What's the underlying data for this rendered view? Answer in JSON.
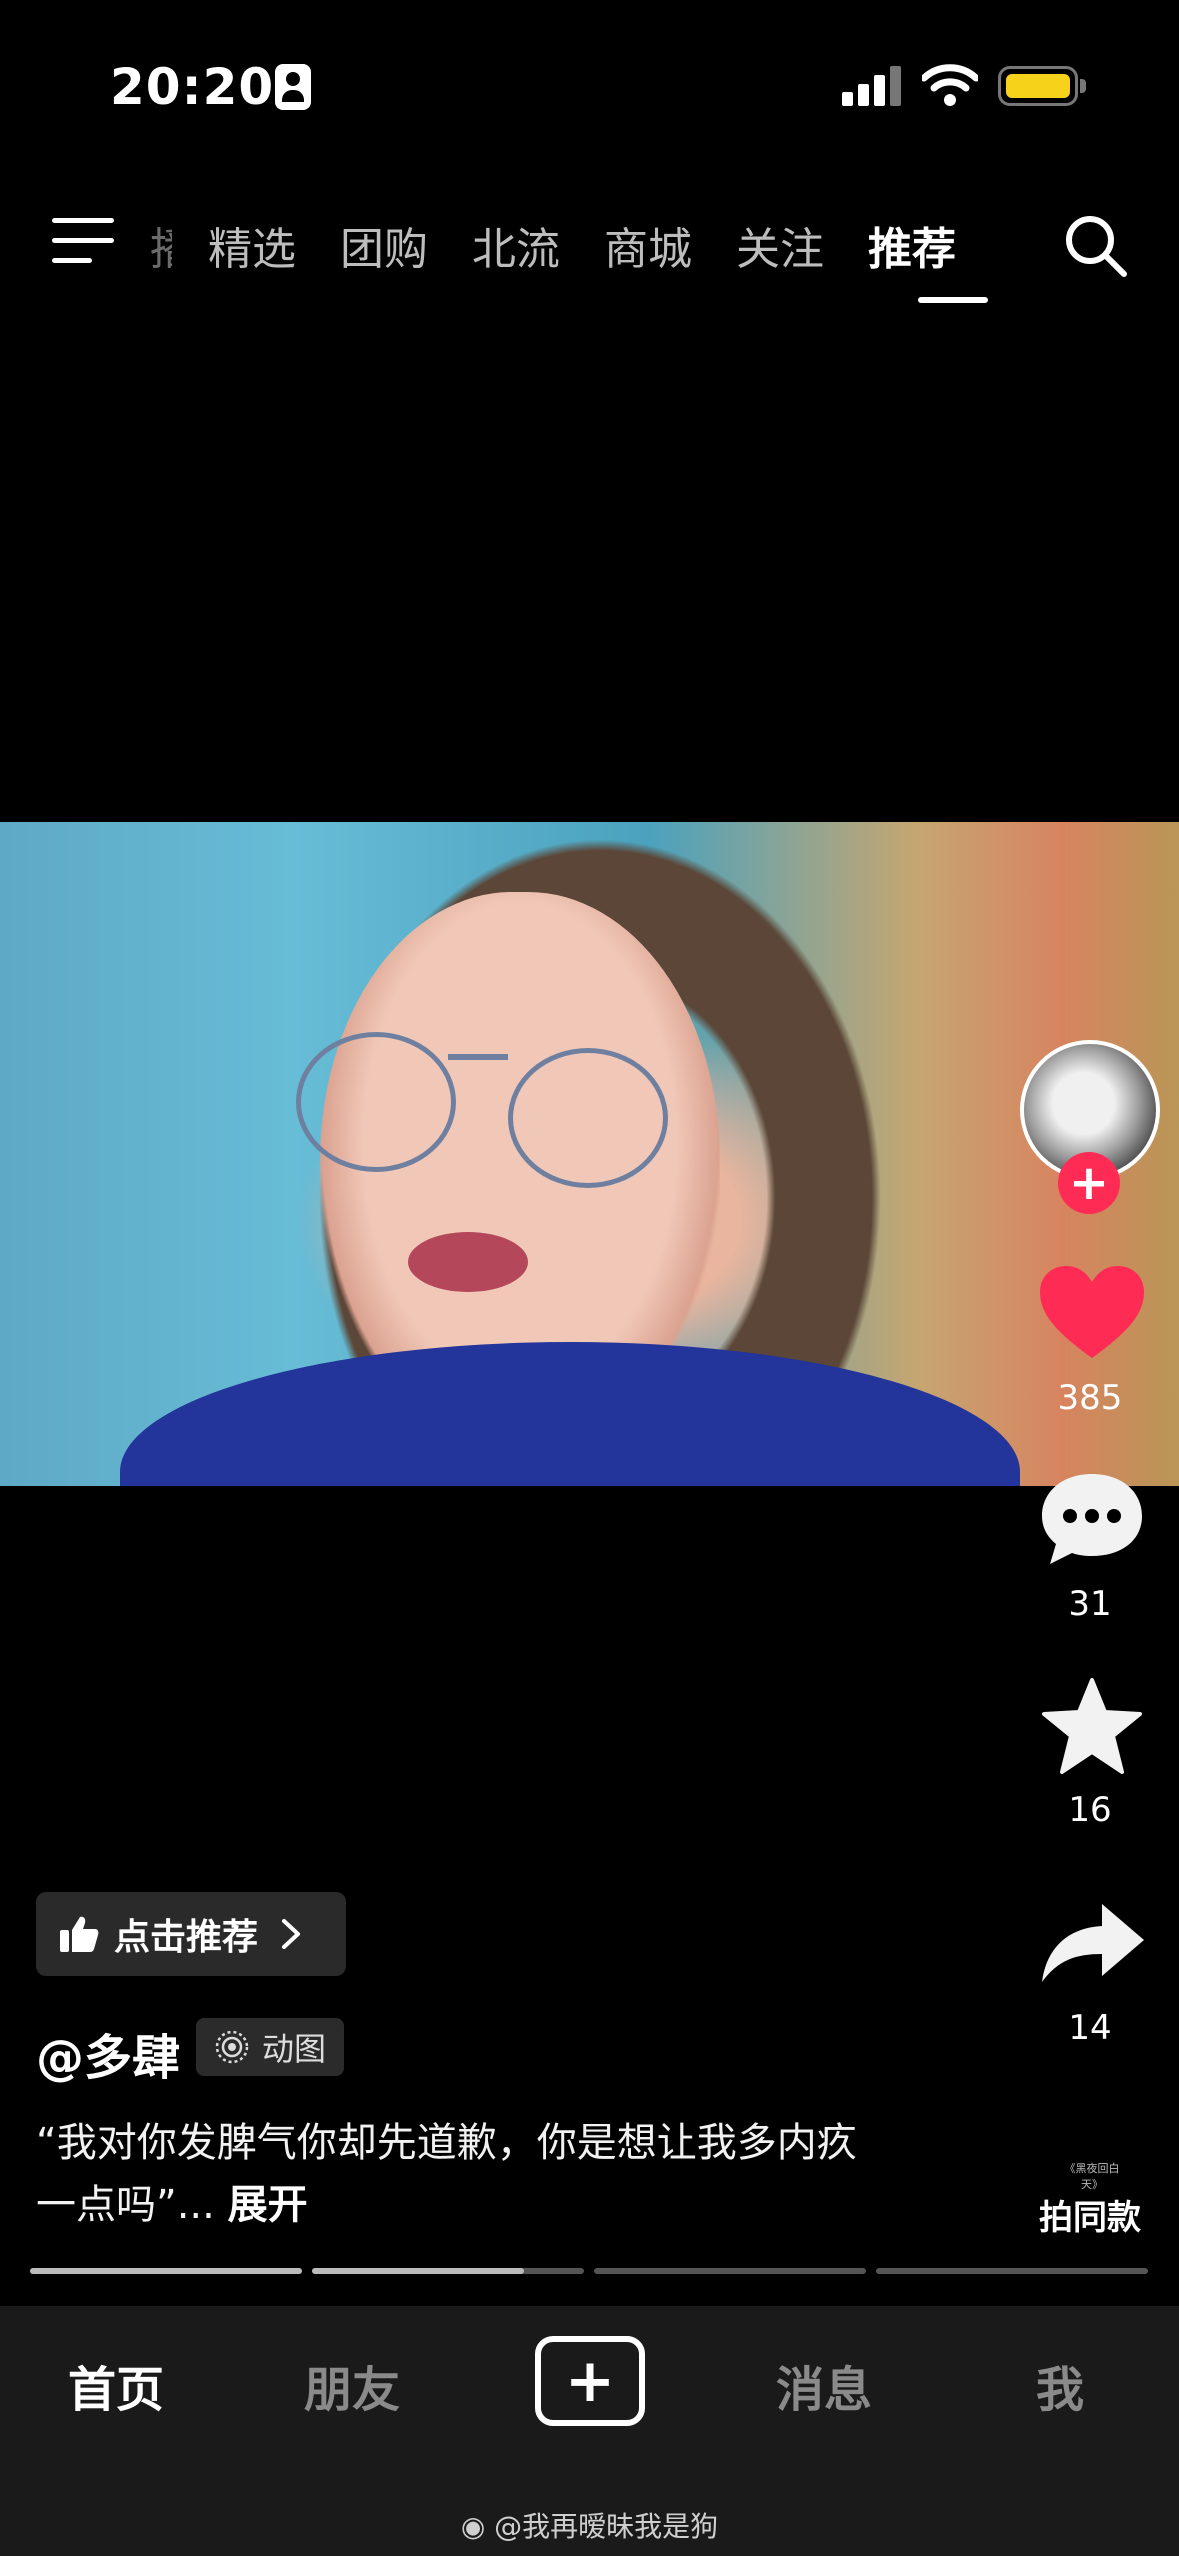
{
  "status_bar": {
    "time": "20:20",
    "battery_color": "#f6d21a"
  },
  "top_nav": {
    "tabs": [
      "播",
      "精选",
      "团购",
      "北流",
      "商城",
      "关注",
      "推荐"
    ],
    "active_tab": "推荐",
    "icons": {
      "menu": "menu-icon",
      "search": "search-icon"
    }
  },
  "right_rail": {
    "likes": "385",
    "comments": "31",
    "favorites": "16",
    "shares": "14",
    "same_style_label": "拍同款",
    "same_style_thumb_text": "《黑夜回白天》",
    "like_color": "#fe2c55"
  },
  "video_info": {
    "recommend_chip": "点击推荐",
    "username": "@多肆",
    "badge": "动图",
    "caption": "“我对你发脾气你却先道歉，你是想让我多内疚一点吗”...",
    "expand_label": "展开"
  },
  "progress": {
    "segments": [
      1.0,
      0.78,
      0,
      0
    ]
  },
  "tab_bar": {
    "home": "首页",
    "friends": "朋友",
    "create": "+",
    "messages": "消息",
    "me": "我"
  },
  "watermark": "@我再暧昧我是狗"
}
